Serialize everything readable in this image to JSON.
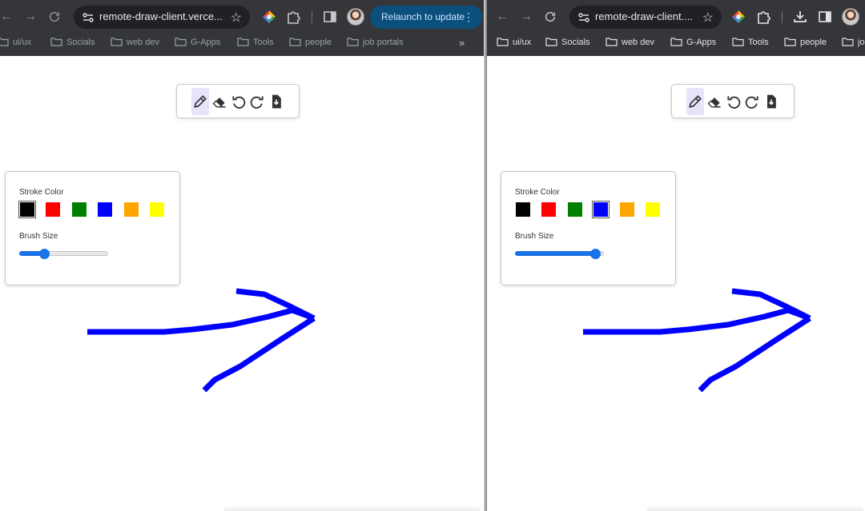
{
  "left_window": {
    "url": "remote-draw-client.verce...",
    "relaunch_label": "Relaunch to update",
    "bookmarks": [
      "ui/ux",
      "Socials",
      "web dev",
      "G-Apps",
      "Tools",
      "people",
      "job portals"
    ],
    "overflow_icon": "chevron-double-right-icon",
    "panel": {
      "stroke_label": "Stroke Color",
      "brush_label": "Brush Size",
      "selected_color_index": 0,
      "brush_size_fraction": 0.26
    }
  },
  "right_window": {
    "url": "remote-draw-client....",
    "bookmarks": [
      "ui/ux",
      "Socials",
      "web dev",
      "G-Apps",
      "Tools",
      "people",
      "job"
    ],
    "panel": {
      "stroke_label": "Stroke Color",
      "brush_label": "Brush Size",
      "selected_color_index": 3,
      "brush_size_fraction": 0.96
    }
  },
  "tools": [
    "pencil-icon",
    "eraser-icon",
    "undo-icon",
    "redo-icon",
    "download-icon"
  ],
  "colors": [
    "#000000",
    "#ff0000",
    "#008000",
    "#0000ff",
    "#ffa500",
    "#ffff00"
  ],
  "stroke_color": "#0000ff",
  "accent_color": "#1a73e8"
}
